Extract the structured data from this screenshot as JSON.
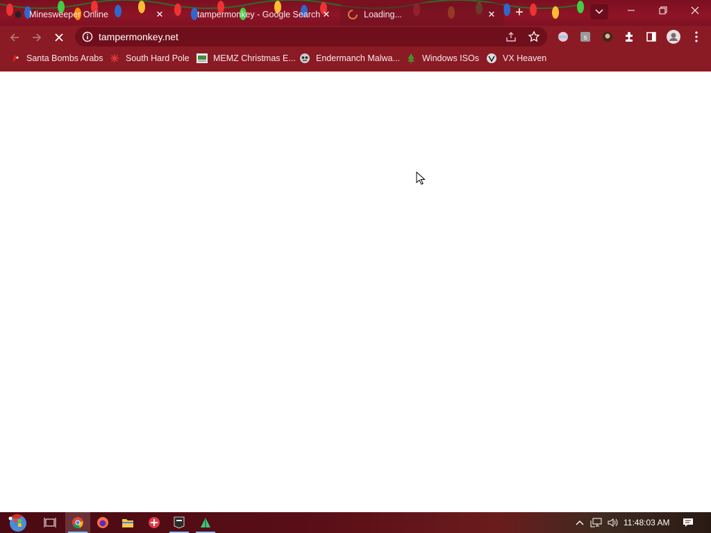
{
  "browser": {
    "tabs": [
      {
        "title": "Minesweeper Online",
        "state": "inactive",
        "icon": "minesweeper-favicon"
      },
      {
        "title": "tampermonkey - Google Search",
        "state": "inactive",
        "icon": "google-favicon"
      },
      {
        "title": "Loading...",
        "state": "active",
        "icon": "loading-spinner"
      }
    ],
    "new_tab_label": "+",
    "address": "tampermonkey.net",
    "bookmarks": [
      {
        "label": "Santa Bombs Arabs",
        "icon": "santa-icon"
      },
      {
        "label": "South Hard Pole",
        "icon": "snowflake-icon"
      },
      {
        "label": "MEMZ Christmas E...",
        "icon": "memz-icon"
      },
      {
        "label": "Endermanch Malwa...",
        "icon": "endermanch-icon"
      },
      {
        "label": "Windows ISOs",
        "icon": "tree-icon"
      },
      {
        "label": "VX Heaven",
        "icon": "vx-icon"
      }
    ],
    "colors": {
      "frame": "#8a1a24",
      "omnibox": "#6e0f1b",
      "content": "#ffffff"
    }
  },
  "taskbar": {
    "clock": "11:48:03 AM",
    "apps": [
      "start-orb",
      "task-view",
      "chrome",
      "firefox",
      "file-explorer",
      "app-red",
      "epic-games",
      "app-green"
    ]
  }
}
